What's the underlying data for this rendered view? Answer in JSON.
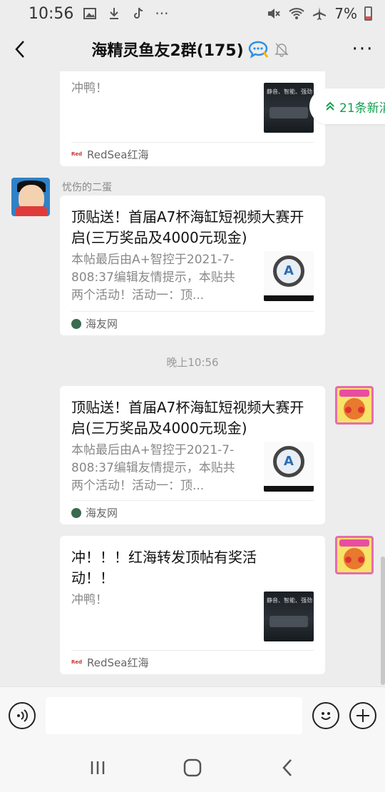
{
  "status_bar": {
    "time": "10:56",
    "battery": "7%",
    "icons_left": [
      "image-icon",
      "download-icon",
      "tiktok-icon",
      "more-dots-icon"
    ],
    "more": "···",
    "icons_right": [
      "mute-icon",
      "wifi-icon",
      "airplane-icon",
      "battery-icon"
    ]
  },
  "header": {
    "title": "海精灵鱼友2群(175)",
    "more": "···"
  },
  "new_messages": {
    "label": "21条新消"
  },
  "messages": [
    {
      "type": "link_card",
      "side": "left",
      "description": "冲鸭！",
      "thumb_text": "静音、智能、强劲",
      "source": "RedSea红海"
    },
    {
      "type": "link_card",
      "side": "left",
      "sender": "忧伤的二蛋",
      "title": "顶贴送！首届A7杯海缸短视频大赛开启(三万奖品及4000元现金)",
      "description": "本帖最后由A+智控于2021-7-808:37编辑友情提示，本贴共两个活动！活动一：顶...",
      "thumb_letter": "A",
      "source": "海友网"
    },
    {
      "type": "timestamp",
      "text": "晚上10:56"
    },
    {
      "type": "link_card",
      "side": "right",
      "title": "顶贴送！首届A7杯海缸短视频大赛开启(三万奖品及4000元现金)",
      "description": "本帖最后由A+智控于2021-7-808:37编辑友情提示，本贴共两个活动！活动一：顶...",
      "thumb_letter": "A",
      "source": "海友网"
    },
    {
      "type": "link_card",
      "side": "right",
      "title": "冲！！！红海转发顶帖有奖活动！！",
      "description": "冲鸭！",
      "thumb_text": "静音、智能、强劲",
      "source": "RedSea红海"
    }
  ],
  "input_bar": {
    "placeholder": ""
  },
  "colors": {
    "background": "#ededed",
    "accent_green": "#10a050"
  }
}
